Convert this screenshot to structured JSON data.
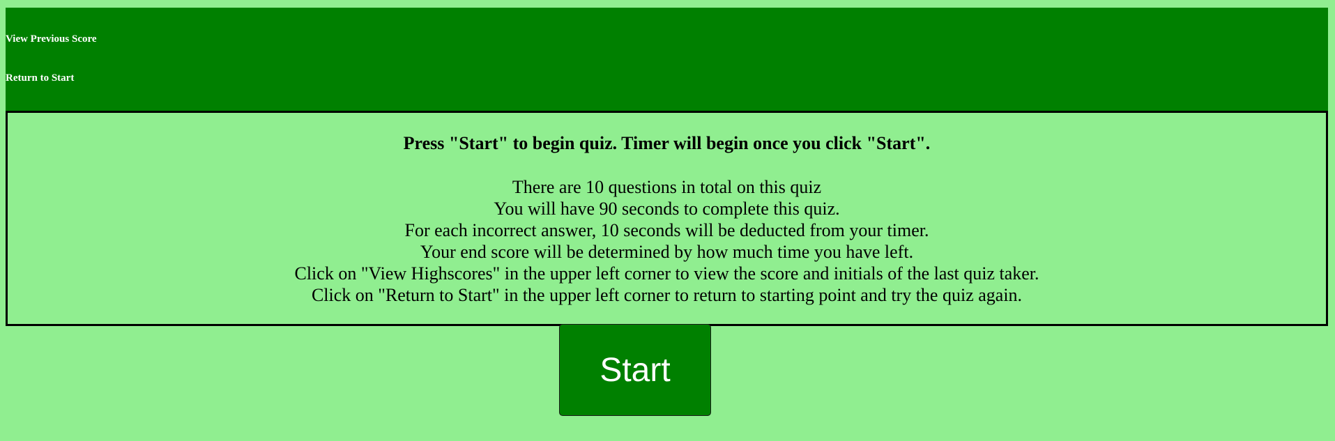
{
  "nav": {
    "view_previous_score": "View Previous Score",
    "return_to_start": "Return to Start"
  },
  "intro": {
    "heading": "Press \"Start\" to begin quiz. Timer will begin once you click \"Start\".",
    "lines": [
      "There are 10 questions in total on this quiz",
      "You will have 90 seconds to complete this quiz.",
      "For each incorrect answer, 10 seconds will be deducted from your timer.",
      "Your end score will be determined by how much time you have left.",
      "Click on \"View Highscores\" in the upper left corner to view the score and initials of the last quiz taker.",
      "Click on \"Return to Start\" in the upper left corner to return to starting point and try the quiz again."
    ]
  },
  "start_button": {
    "label": "Start"
  },
  "colors": {
    "background": "#90EE90",
    "header": "#008000",
    "button": "#008000",
    "text_light": "#ffffff",
    "text_dark": "#000000"
  }
}
